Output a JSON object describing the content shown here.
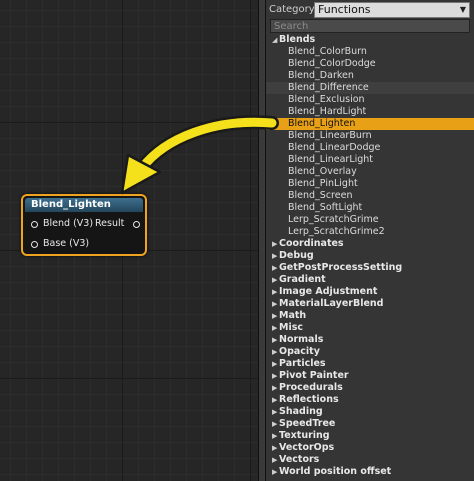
{
  "palette": {
    "category_label": "Category:",
    "category_value": "Functions",
    "search_placeholder": "Search",
    "blends_group": "Blends",
    "blend_items": [
      "Blend_ColorBurn",
      "Blend_ColorDodge",
      "Blend_Darken",
      "Blend_Difference",
      "Blend_Exclusion",
      "Blend_HardLight",
      "Blend_Lighten",
      "Blend_LinearBurn",
      "Blend_LinearDodge",
      "Blend_LinearLight",
      "Blend_Overlay",
      "Blend_PinLight",
      "Blend_Screen",
      "Blend_SoftLight",
      "Lerp_ScratchGrime",
      "Lerp_ScratchGrime2"
    ],
    "selected_item": "Blend_Lighten",
    "groups": [
      "Coordinates",
      "Debug",
      "GetPostProcessSetting",
      "Gradient",
      "Image Adjustment",
      "MaterialLayerBlend",
      "Math",
      "Misc",
      "Normals",
      "Opacity",
      "Particles",
      "Pivot Painter",
      "Procedurals",
      "Reflections",
      "Shading",
      "SpeedTree",
      "Texturing",
      "VectorOps",
      "Vectors",
      "World position offset"
    ]
  },
  "node": {
    "title": "Blend_Lighten",
    "inputs": [
      "Blend (V3)",
      "Base (V3)"
    ],
    "output": "Result"
  },
  "colors": {
    "selection": "#e8a017",
    "node_border": "#f0a321",
    "arrow": "#f5e11b"
  },
  "icons": [
    "expanded-triangle-icon",
    "collapsed-triangle-icon",
    "dropdown-arrow-icon",
    "pin-circle-icon",
    "curved-arrow-icon"
  ]
}
